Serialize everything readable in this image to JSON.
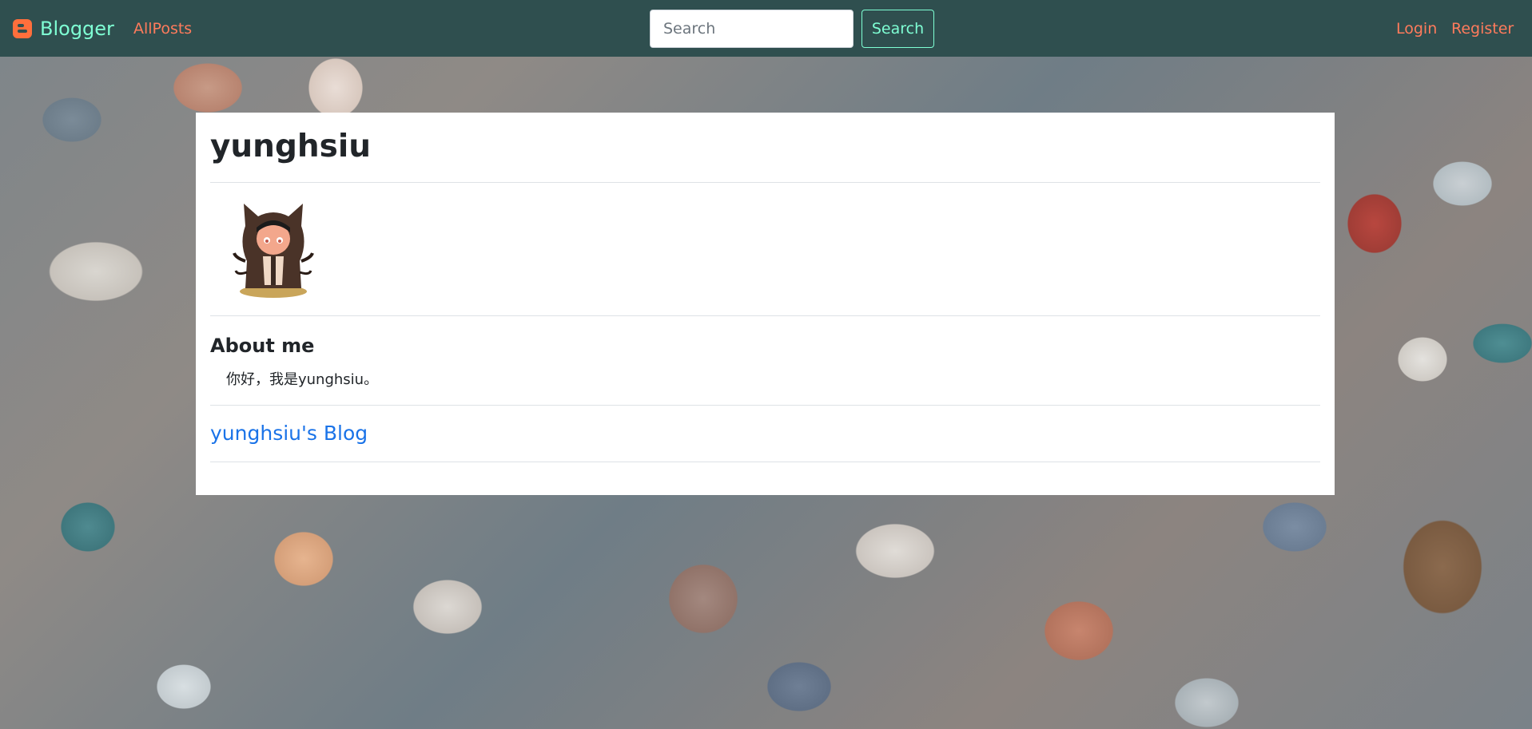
{
  "navbar": {
    "brand_label": "Blogger",
    "brand_icon": "blogger-icon",
    "allposts_label": "AllPosts",
    "search_placeholder": "Search",
    "search_button_label": "Search",
    "login_label": "Login",
    "register_label": "Register",
    "colors": {
      "background": "#2f4f4f",
      "brand": "#7fffd4",
      "link": "#ff7b5c"
    }
  },
  "profile": {
    "username": "yunghsiu",
    "avatar_icon": "octocat-avatar-icon",
    "about_heading": "About me",
    "about_text": "你好，我是yunghsiu。",
    "blog_link_label": "yunghsiu's Blog"
  }
}
